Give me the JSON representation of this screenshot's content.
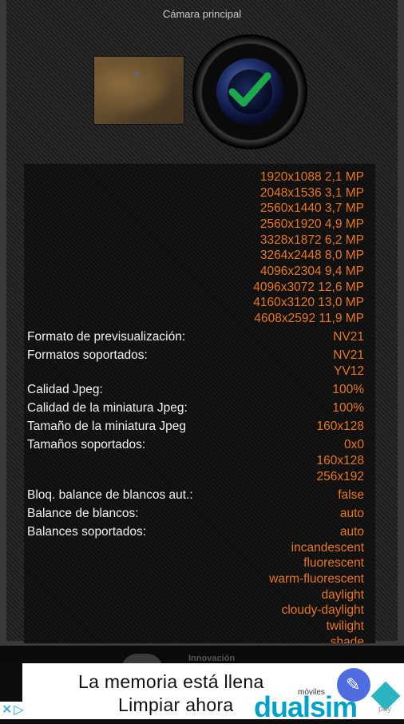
{
  "header": {
    "title": "Cámara principal"
  },
  "icons": {
    "lens": "camera-lens-check-icon"
  },
  "resolutions": [
    "1920x1088 2,1 MP",
    "2048x1536 3,1 MP",
    "2560x1440 3,7 MP",
    "2560x1920 4,9 MP",
    "3328x1872 6,2 MP",
    "3264x2448 8,0 MP",
    "4096x2304 9,4 MP",
    "4096x3072 12,6 MP",
    "4160x3120 13,0 MP",
    "4608x2592 11,9 MP"
  ],
  "props": {
    "preview_format": {
      "label": "Formato de previsualización:",
      "value": "NV21"
    },
    "supported_formats": {
      "label": "Formatos soportados:",
      "values": [
        "NV21",
        "YV12"
      ]
    },
    "jpeg_quality": {
      "label": "Calidad Jpeg:",
      "value": "100%"
    },
    "thumb_quality": {
      "label": "Calidad de la miniatura Jpeg:",
      "value": "100%"
    },
    "thumb_size": {
      "label": "Tamaño de la miniatura Jpeg",
      "value": "160x128"
    },
    "supported_sizes": {
      "label": "Tamaños soportados:",
      "values": [
        "0x0",
        "160x128",
        "256x192"
      ]
    },
    "awb_lock": {
      "label": "Bloq. balance de blancos aut.:",
      "value": "false"
    },
    "white_balance": {
      "label": "Balance de blancos:",
      "value": "auto"
    },
    "supported_wb": {
      "label": "Balances soportados:",
      "values": [
        "auto",
        "incandescent",
        "fluorescent",
        "warm-fluorescent",
        "daylight",
        "cloudy-daylight",
        "twilight",
        "shade"
      ]
    }
  },
  "footer": {
    "brand_text": "Innovación"
  },
  "ad": {
    "line1": "La memoria está llena",
    "line2": "Limpiar ahora",
    "brand": "dualsim",
    "brand_small": "móviles",
    "badge_icon": "cleaner-brush-icon",
    "pay_text": "pay"
  },
  "adchoices": {
    "label": "▷"
  },
  "colors": {
    "value": "#e8761e",
    "label": "#f2f2f2",
    "brand": "#00a3c7"
  }
}
